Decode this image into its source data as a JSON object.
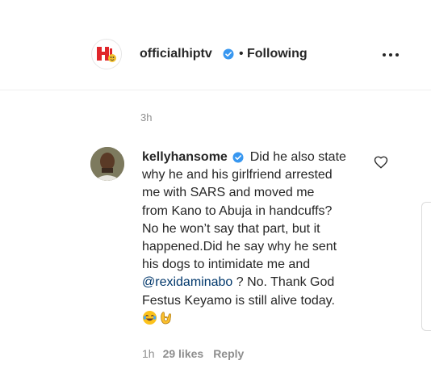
{
  "header": {
    "username": "officialhiptv",
    "separator": "•",
    "follow_status": "Following",
    "more_icon": "more-horizontal-icon",
    "verified_icon": "verified-badge-icon",
    "avatar_icon": "hiptv-logo"
  },
  "post": {
    "time": "3h"
  },
  "comment": {
    "username": "kellyhansome",
    "lines": [
      "Did he also state",
      "why he and his girlfriend arrested",
      "me with SARS and moved me",
      "from Kano to Abuja in handcuffs?",
      "No he won’t say that part, but it",
      "happened.Did he say why he sent",
      "his dogs to intimidate me and"
    ],
    "mention": "@rexidaminabo",
    "after_mention": " ? No. Thank God",
    "line9": "Festus Keyamo is still alive today.",
    "emojis": [
      "😂",
      "👌"
    ],
    "time": "1h",
    "likes": "29 likes",
    "reply_label": "Reply",
    "like_icon": "heart-outline-icon"
  },
  "colors": {
    "text": "#262626",
    "secondary": "#8e8e8e",
    "link": "#00376b",
    "verified": "#3897f0",
    "border": "#efefef"
  }
}
